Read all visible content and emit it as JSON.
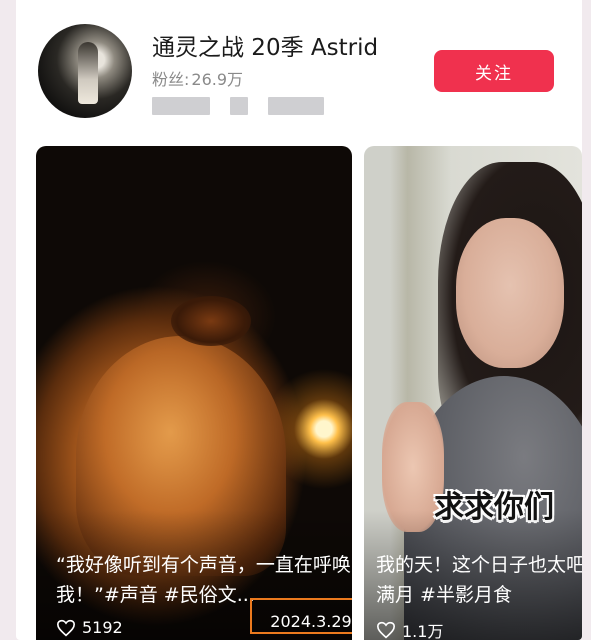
{
  "profile": {
    "name": "通灵之战 20季 Astrid",
    "fans_label": "粉丝:",
    "fans_count": "26.9万",
    "follow_label": "关注"
  },
  "videos": [
    {
      "caption": "“我好像听到有个声音，一直在呼唤我！”#声音 #民俗文...",
      "likes": "5192",
      "date": "2024.3.29"
    },
    {
      "caption": "我的天！这个日子也太吧！ #满月 #半影月食",
      "likes": "1.1万",
      "overlay_text": "求求你们"
    }
  ],
  "colors": {
    "follow_button": "#f0314e",
    "highlight_box": "#ec7a1e"
  }
}
